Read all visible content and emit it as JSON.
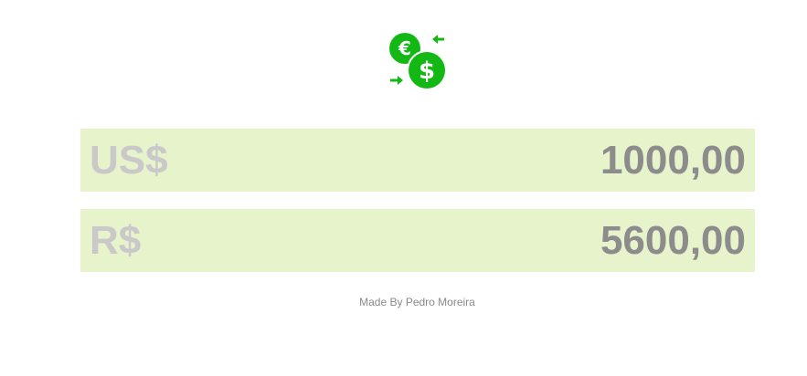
{
  "logo": {
    "icon": "currency-exchange-icon",
    "color": "#14b814"
  },
  "rows": [
    {
      "currency": "US$",
      "amount": "1000,00"
    },
    {
      "currency": "R$",
      "amount": "5600,00"
    }
  ],
  "footer": {
    "text": "Made By Pedro Moreira"
  },
  "colors": {
    "row_background": "#e6f3cb",
    "currency_text": "#c9c9c9",
    "amount_text": "#8c8c8c"
  }
}
